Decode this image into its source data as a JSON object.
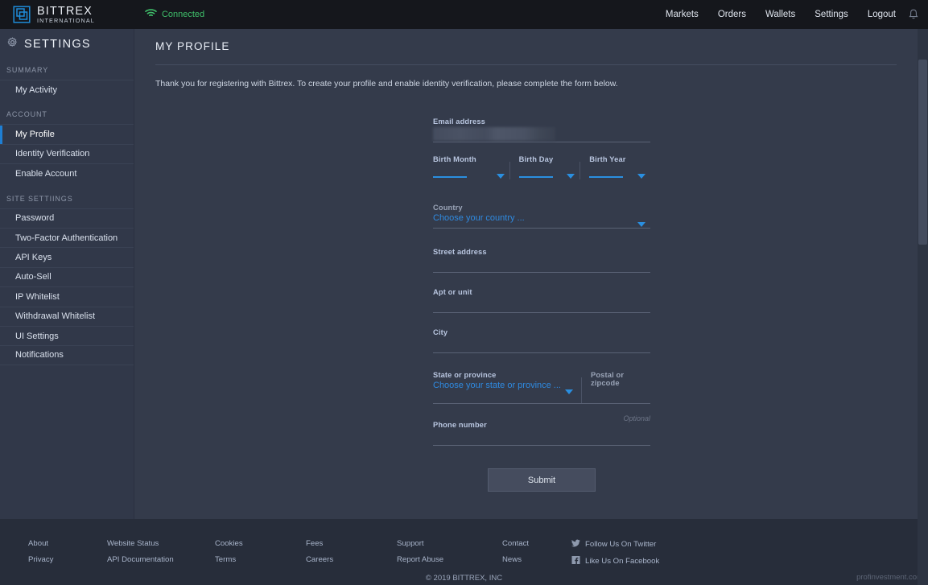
{
  "colors": {
    "accent_blue": "#2f8ae0",
    "header_bg": "#15171c",
    "page_bg": "#343b4b",
    "sidebar_bg": "#313849",
    "footer_bg": "#272d3a",
    "connected_green": "#3fbf6a"
  },
  "header": {
    "logo_primary": "BITTREX",
    "logo_secondary": "INTERNATIONAL",
    "logo_icon": "bittrex-square-logo-icon",
    "connection_icon": "wifi-icon",
    "connection_status": "Connected",
    "nav": [
      {
        "label": "Markets"
      },
      {
        "label": "Orders"
      },
      {
        "label": "Wallets"
      },
      {
        "label": "Settings"
      },
      {
        "label": "Logout"
      }
    ],
    "notification_icon": "bell-icon"
  },
  "sidebar": {
    "icon": "gear-icon",
    "title": "SETTINGS",
    "groups": [
      {
        "title": "SUMMARY",
        "items": [
          {
            "label": "My Activity",
            "active": false
          }
        ]
      },
      {
        "title": "ACCOUNT",
        "items": [
          {
            "label": "My Profile",
            "active": true
          },
          {
            "label": "Identity Verification",
            "active": false
          },
          {
            "label": "Enable Account",
            "active": false
          }
        ]
      },
      {
        "title": "SITE SETTIINGS",
        "items": [
          {
            "label": "Password",
            "active": false
          },
          {
            "label": "Two-Factor Authentication",
            "active": false
          },
          {
            "label": "API Keys",
            "active": false
          },
          {
            "label": "Auto-Sell",
            "active": false
          },
          {
            "label": "IP Whitelist",
            "active": false
          },
          {
            "label": "Withdrawal Whitelist",
            "active": false
          },
          {
            "label": "UI Settings",
            "active": false
          },
          {
            "label": "Notifications",
            "active": false
          }
        ]
      }
    ]
  },
  "main": {
    "page_title": "MY PROFILE",
    "intro": "Thank you for registering with Bittrex. To create your profile and enable identity verification, please complete the form below.",
    "form": {
      "email": {
        "label": "Email address",
        "value": "",
        "redacted": true
      },
      "birth_month": {
        "label": "Birth Month",
        "value": "",
        "caret_icon": "chevron-down-icon"
      },
      "birth_day": {
        "label": "Birth Day",
        "value": "",
        "caret_icon": "chevron-down-icon"
      },
      "birth_year": {
        "label": "Birth Year",
        "value": "",
        "caret_icon": "chevron-down-icon"
      },
      "country": {
        "label": "Country",
        "placeholder": "Choose your country ...",
        "caret_icon": "chevron-down-icon"
      },
      "street_address": {
        "label": "Street address",
        "value": ""
      },
      "apt_or_unit": {
        "label": "Apt or unit",
        "value": ""
      },
      "city": {
        "label": "City",
        "value": ""
      },
      "state_or_province": {
        "label": "State or province",
        "placeholder": "Choose your state or province ...",
        "caret_icon": "chevron-down-icon"
      },
      "postal_or_zipcode": {
        "label": "Postal or zipcode",
        "value": ""
      },
      "phone_number": {
        "label": "Phone number",
        "value": "",
        "hint": "Optional"
      },
      "submit_label": "Submit"
    }
  },
  "footer": {
    "columns": [
      {
        "links": [
          {
            "label": "About"
          },
          {
            "label": "Privacy"
          }
        ]
      },
      {
        "links": [
          {
            "label": "Website Status"
          },
          {
            "label": "API Documentation"
          }
        ]
      },
      {
        "links": [
          {
            "label": "Cookies"
          },
          {
            "label": "Terms"
          }
        ]
      },
      {
        "links": [
          {
            "label": "Fees"
          },
          {
            "label": "Careers"
          }
        ]
      },
      {
        "links": [
          {
            "label": "Support"
          },
          {
            "label": "Report Abuse"
          }
        ]
      },
      {
        "links": [
          {
            "label": "Contact"
          },
          {
            "label": "News"
          }
        ]
      }
    ],
    "social": [
      {
        "icon": "twitter-icon",
        "label": "Follow Us On Twitter"
      },
      {
        "icon": "facebook-icon",
        "label": "Like Us On Facebook"
      }
    ],
    "copyright": "© 2019 BITTREX, INC",
    "watermark": "profinvestment.com"
  }
}
